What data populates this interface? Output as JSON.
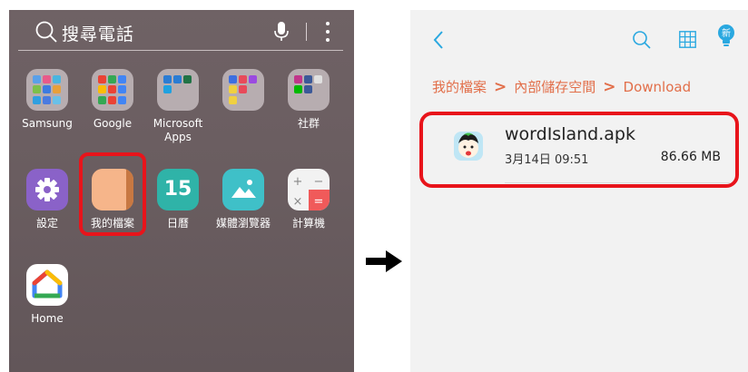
{
  "left": {
    "search_placeholder": "搜尋電話",
    "apps": [
      {
        "label": "Samsung"
      },
      {
        "label": "Google"
      },
      {
        "label": "Microsoft Apps"
      },
      {
        "label": "社群"
      },
      {
        "label": "設定"
      },
      {
        "label": "我的檔案"
      },
      {
        "label": "日曆",
        "day": "15"
      },
      {
        "label": "媒體瀏覽器"
      },
      {
        "label": "計算機"
      },
      {
        "label": "Home"
      }
    ]
  },
  "right": {
    "breadcrumb": [
      "我的檔案",
      "內部儲存空間",
      "Download"
    ],
    "new_badge": "新",
    "file": {
      "name": "wordIsland.apk",
      "date": "3月14日 09:51",
      "size": "86.66 MB"
    }
  },
  "colors": {
    "highlight": "#e8141b",
    "accent": "#e26f4a",
    "icon_blue": "#2aa8e0"
  }
}
